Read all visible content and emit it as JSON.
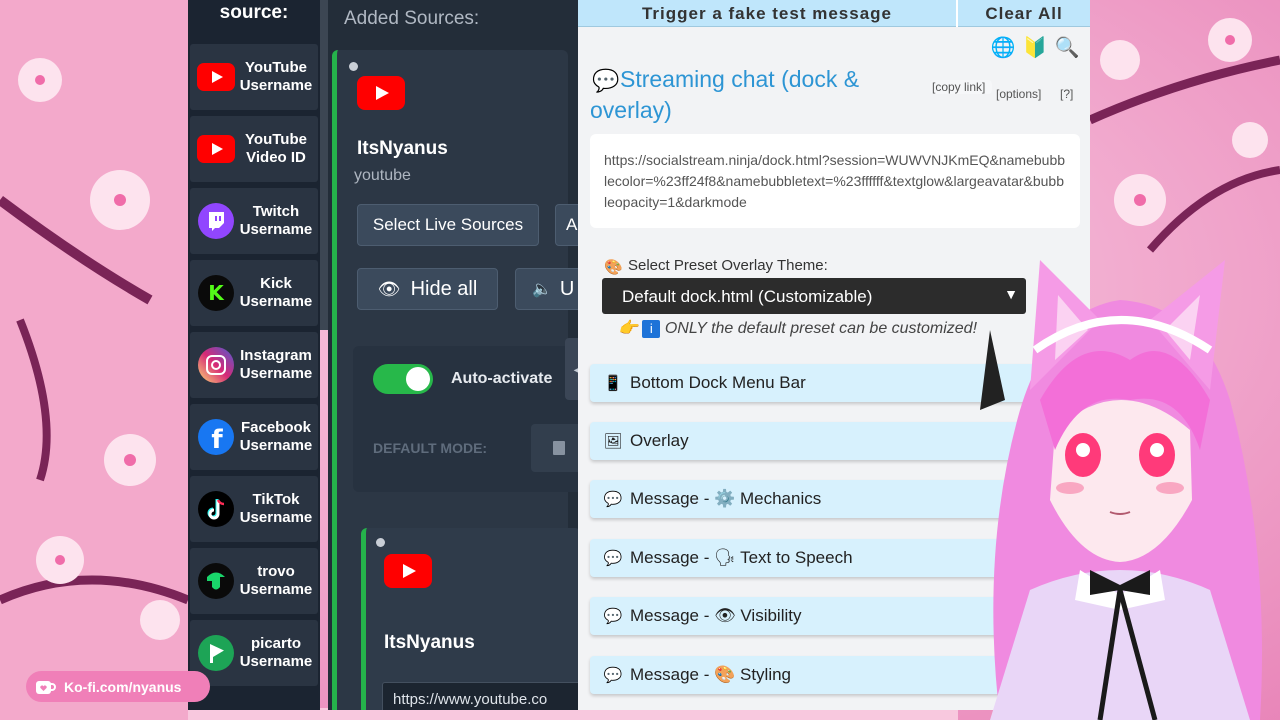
{
  "sources": {
    "title": "source:",
    "items": [
      {
        "label": "YouTube Username",
        "icon": "youtube-icon"
      },
      {
        "label": "YouTube Video ID",
        "icon": "youtube-icon"
      },
      {
        "label": "Twitch Username",
        "icon": "twitch-icon"
      },
      {
        "label": "Kick Username",
        "icon": "kick-icon"
      },
      {
        "label": "Instagram Username",
        "icon": "instagram-icon"
      },
      {
        "label": "Facebook Username",
        "icon": "facebook-icon"
      },
      {
        "label": "TikTok Username",
        "icon": "tiktok-icon"
      },
      {
        "label": "trovo Username",
        "icon": "trovo-icon"
      },
      {
        "label": "picarto Username",
        "icon": "picarto-icon"
      }
    ]
  },
  "added": {
    "title": "Added Sources:",
    "card1": {
      "name": "ItsNyanus",
      "platform": "youtube",
      "select_live": "Select Live Sources",
      "hide_all": "Hide all",
      "btn_cut": "A",
      "btn_cut2": "U",
      "auto_activate": "Auto-activate",
      "default_mode": "DEFAULT MODE:"
    },
    "card2": {
      "name": "ItsNyanus",
      "url": "https://www.youtube.co"
    }
  },
  "right": {
    "trigger": "Trigger a fake test message",
    "clear": "Clear All",
    "stream_title": "Streaming chat (dock & overlay)",
    "copy_link": "[copy link]",
    "options": "[options]",
    "help": "[?]",
    "url": "https://socialstream.ninja/dock.html?session=WUWVNJKmEQ&namebubblecolor=%23ff24f8&namebubbletext=%23ffffff&textglow&largeavatar&bubbleopacity=1&darkmode",
    "theme_label": "Select Preset Overlay Theme:",
    "theme_value": "Default dock.html (Customizable)",
    "theme_note": "ONLY the default preset can be customized!",
    "sections": [
      {
        "label": "Bottom Dock Menu Bar",
        "icon": "phone-icon"
      },
      {
        "label": "Overlay",
        "icon": "picture-icon"
      },
      {
        "label": "Message - ⚙️ Mechanics",
        "icon": "speech-icon"
      },
      {
        "label": "Message - 🗣 Text to Speech",
        "icon": "speech-icon"
      },
      {
        "label": "Message - 👁 Visibility",
        "icon": "speech-icon"
      },
      {
        "label": "Message - 🎨 Styling",
        "icon": "speech-icon"
      }
    ]
  },
  "kofi": {
    "label": "Ko-fi.com/nyanus"
  },
  "colors": {
    "accent": "#2d95d4",
    "live_green": "#25b34b",
    "youtube_red": "#ff0000",
    "panel_dark": "#232d39"
  }
}
